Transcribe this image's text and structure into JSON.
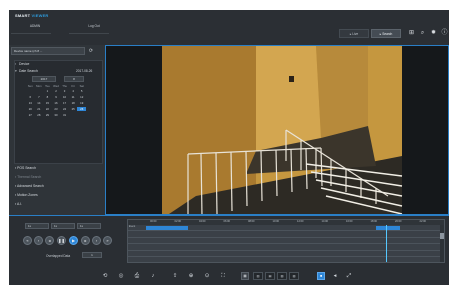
{
  "header": {
    "brand": "SMART",
    "brand_accent": "VIEWER",
    "admin": "ADMIN",
    "logout": "Log Out",
    "tab_live": "Live",
    "tab_search": "Search"
  },
  "left_panel": {
    "device_select": "Device name (ch 8 ...",
    "nav_device": "Device",
    "nav_date_search": "Date Search",
    "date_value": "2017-08-26",
    "year": "2017",
    "month": "8",
    "weekdays": [
      "Sun",
      "Mon",
      "Tue",
      "Wed",
      "Thu",
      "Fri",
      "Sat"
    ],
    "calendar_days": [
      "",
      "",
      "1",
      "2",
      "3",
      "4",
      "5",
      "6",
      "7",
      "8",
      "9",
      "10",
      "11",
      "12",
      "13",
      "14",
      "15",
      "16",
      "17",
      "18",
      "19",
      "20",
      "21",
      "22",
      "23",
      "24",
      "25",
      "26",
      "27",
      "28",
      "29",
      "30",
      "31",
      "",
      ""
    ],
    "selected_day": "26",
    "nav_pos_search": "POS Search",
    "nav_dimmed": "Thermal Search",
    "nav_advanced_search": "Advanced Search",
    "nav_motion_zones": "Motion Zones",
    "nav_ai": "A.I."
  },
  "controls": {
    "speed_1": "1x",
    "speed_2": "1x",
    "speed_3": "1x",
    "overlapped_label": "Overlapped Data",
    "overlapped_value": "1"
  },
  "timeline": {
    "hours": [
      "00:00",
      "02:00",
      "04:00",
      "06:00",
      "08:00",
      "10:00",
      "12:00",
      "14:00",
      "16:00",
      "18:00",
      "20:00",
      "22:00"
    ],
    "rows": [
      "Event",
      "",
      "",
      "",
      "",
      ""
    ]
  },
  "colors": {
    "accent": "#2e86d6",
    "panel": "#2c3035",
    "video_wall": "#c79a3a"
  }
}
